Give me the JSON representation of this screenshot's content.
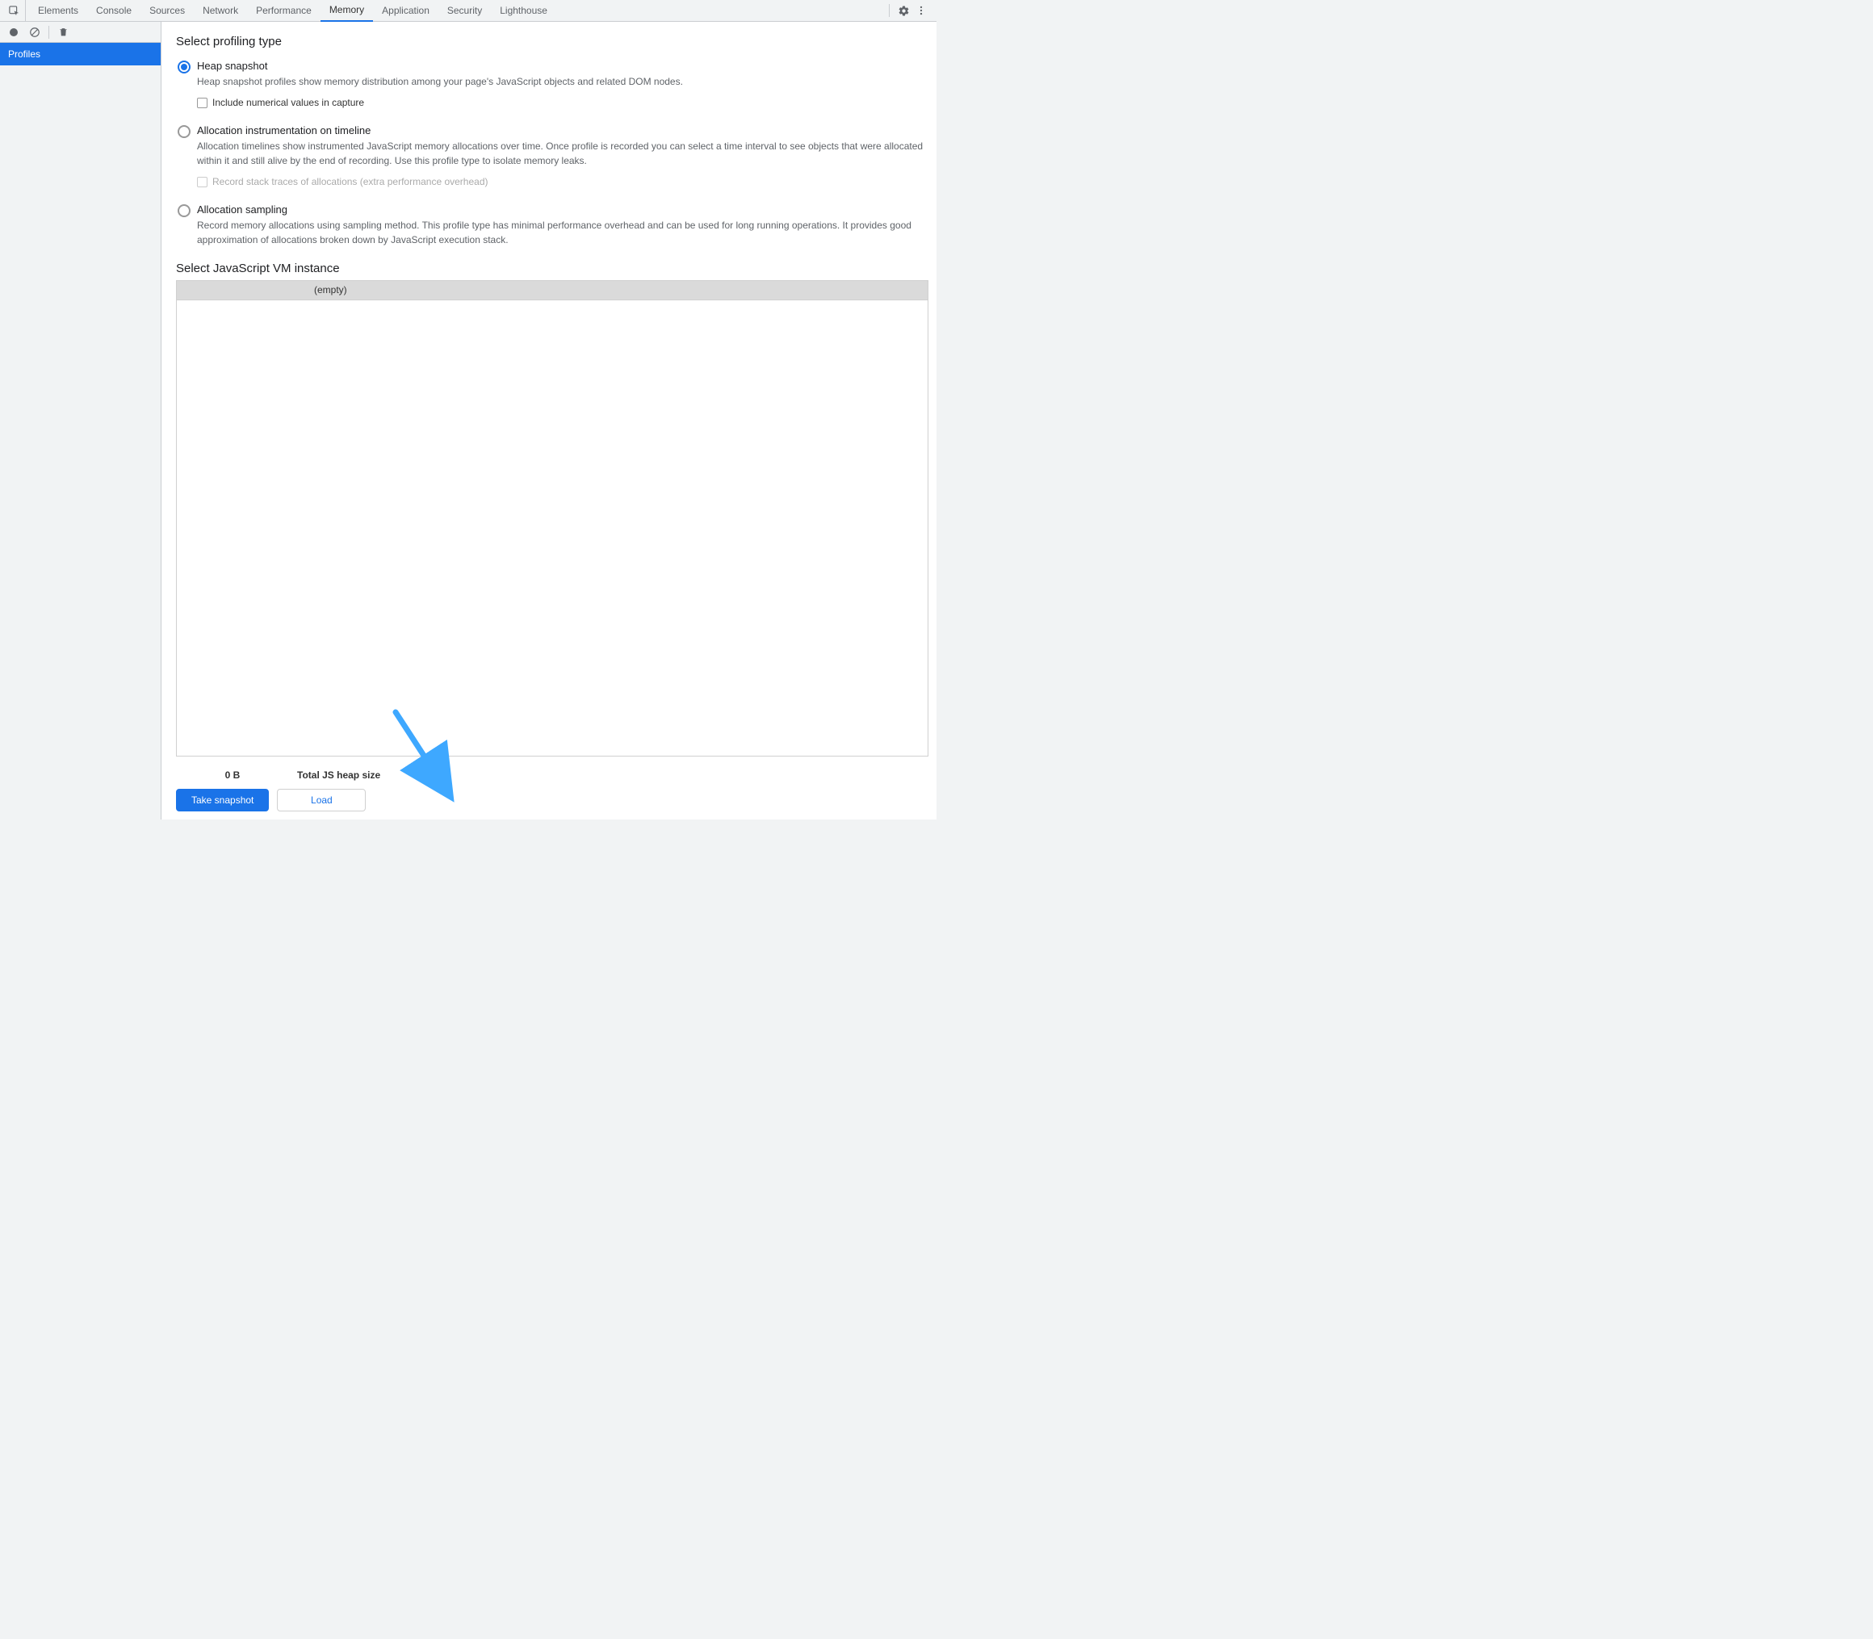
{
  "tabs": [
    "Elements",
    "Console",
    "Sources",
    "Network",
    "Performance",
    "Memory",
    "Application",
    "Security",
    "Lighthouse"
  ],
  "activeTab": "Memory",
  "sidebar": {
    "items": [
      "Profiles"
    ]
  },
  "main": {
    "profilingTypeTitle": "Select profiling type",
    "options": [
      {
        "label": "Heap snapshot",
        "desc": "Heap snapshot profiles show memory distribution among your page's JavaScript objects and related DOM nodes.",
        "checked": true,
        "sub": {
          "label": "Include numerical values in capture",
          "disabled": false
        }
      },
      {
        "label": "Allocation instrumentation on timeline",
        "desc": "Allocation timelines show instrumented JavaScript memory allocations over time. Once profile is recorded you can select a time interval to see objects that were allocated within it and still alive by the end of recording. Use this profile type to isolate memory leaks.",
        "checked": false,
        "sub": {
          "label": "Record stack traces of allocations (extra performance overhead)",
          "disabled": true
        }
      },
      {
        "label": "Allocation sampling",
        "desc": "Record memory allocations using sampling method. This profile type has minimal performance overhead and can be used for long running operations. It provides good approximation of allocations broken down by JavaScript execution stack.",
        "checked": false
      }
    ],
    "vmTitle": "Select JavaScript VM instance",
    "vmHeader": "(empty)",
    "stats": {
      "value": "0 B",
      "label": "Total JS heap size"
    },
    "buttons": {
      "primary": "Take snapshot",
      "secondary": "Load"
    }
  }
}
